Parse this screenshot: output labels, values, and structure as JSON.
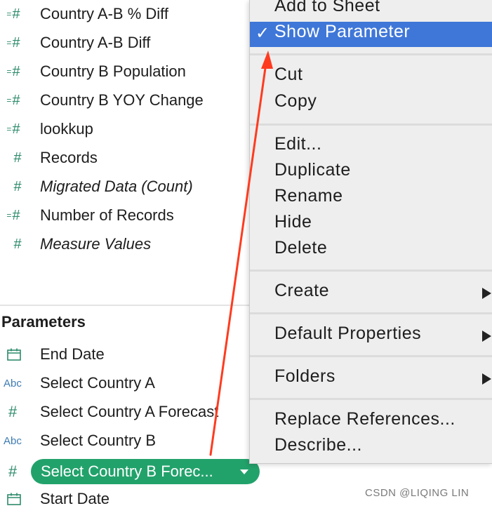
{
  "measures": [
    {
      "label": "Country A-B % Diff",
      "icon": "calc-hash-icon",
      "italic": false
    },
    {
      "label": "Country A-B Diff",
      "icon": "calc-hash-icon",
      "italic": false
    },
    {
      "label": "Country B Population",
      "icon": "calc-hash-icon",
      "italic": false
    },
    {
      "label": "Country B YOY Change",
      "icon": "calc-hash-icon",
      "italic": false
    },
    {
      "label": "lookkup",
      "icon": "calc-hash-icon",
      "italic": false
    },
    {
      "label": "Records",
      "icon": "hash-icon",
      "italic": false
    },
    {
      "label": "Migrated Data (Count)",
      "icon": "hash-icon",
      "italic": true
    },
    {
      "label": "Number of Records",
      "icon": "calc-hash-icon",
      "italic": false
    },
    {
      "label": "Measure Values",
      "icon": "hash-icon",
      "italic": true
    }
  ],
  "parameters": {
    "title": "Parameters",
    "items": [
      {
        "label": "End Date",
        "icon": "calendar-icon",
        "icon_text": ""
      },
      {
        "label": "Select Country A",
        "icon": "abc-icon",
        "icon_text": "Abc"
      },
      {
        "label": "Select Country A Forecast",
        "icon": "hash-icon",
        "icon_text": "#"
      },
      {
        "label": "Select Country B",
        "icon": "abc-icon",
        "icon_text": "Abc"
      },
      {
        "label": "Select Country B Forec...",
        "icon": "hash-icon",
        "icon_text": "#",
        "selected": true
      },
      {
        "label": "Start Date",
        "icon": "calendar-icon",
        "icon_text": ""
      }
    ]
  },
  "menu": {
    "add_to_sheet": "Add to Sheet",
    "show_parameter": "Show Parameter",
    "check_glyph": "✓",
    "cut": "Cut",
    "copy": "Copy",
    "edit": "Edit...",
    "duplicate": "Duplicate",
    "rename": "Rename",
    "hide": "Hide",
    "delete": "Delete",
    "create": "Create",
    "default_properties": "Default Properties",
    "folders": "Folders",
    "replace_references": "Replace References...",
    "describe": "Describe..."
  },
  "colors": {
    "highlight": "#3f77d8",
    "pill": "#22a26b",
    "arrow": "#ff3b1f",
    "measure_icon": "#2e8b6b",
    "abc_icon": "#3e7cb1"
  },
  "watermark": "CSDN @LIQING LIN"
}
